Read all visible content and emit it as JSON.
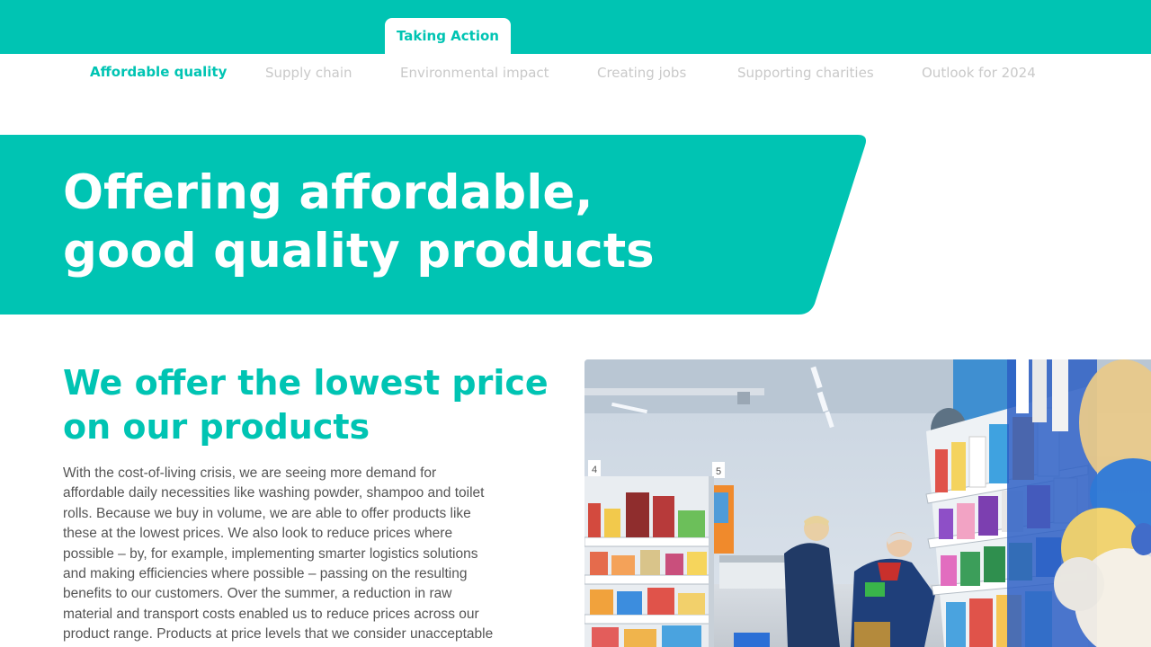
{
  "top_bar": {
    "active_tab": "Taking Action",
    "color": "#00c4b3"
  },
  "subnav": {
    "items": [
      {
        "label": "Affordable quality",
        "active": true
      },
      {
        "label": "Supply chain",
        "active": false
      },
      {
        "label": "Environmental impact",
        "active": false
      },
      {
        "label": "Creating jobs",
        "active": false
      },
      {
        "label": "Supporting charities",
        "active": false
      },
      {
        "label": "Outlook for 2024",
        "active": false
      }
    ]
  },
  "hero": {
    "title_lines": [
      "Offering affordable,",
      "good quality products"
    ]
  },
  "section": {
    "heading_lines": [
      "We offer the lowest price",
      "on our products"
    ],
    "body_lines": [
      "With the cost-of-living crisis, we are seeing more demand for",
      "affordable daily necessities like washing powder, shampoo and toilet",
      "rolls. Because we buy in volume, we are able to offer products like",
      "these at the lowest prices. We also look to reduce prices where",
      "possible – by, for example, implementing smarter logistics solutions",
      "and making efficiencies where possible – passing on the resulting",
      "benefits to our customers. Over the summer, a reduction in raw",
      "material and transport costs enabled us to reduce prices across our",
      "product range. Products at price levels that we consider unacceptable"
    ]
  },
  "photo": {
    "aisle_signs": [
      "4",
      "5"
    ]
  },
  "colors": {
    "accent": "#00c4b3",
    "inactive_nav": "#c9c9c9",
    "body_text": "#555555"
  }
}
